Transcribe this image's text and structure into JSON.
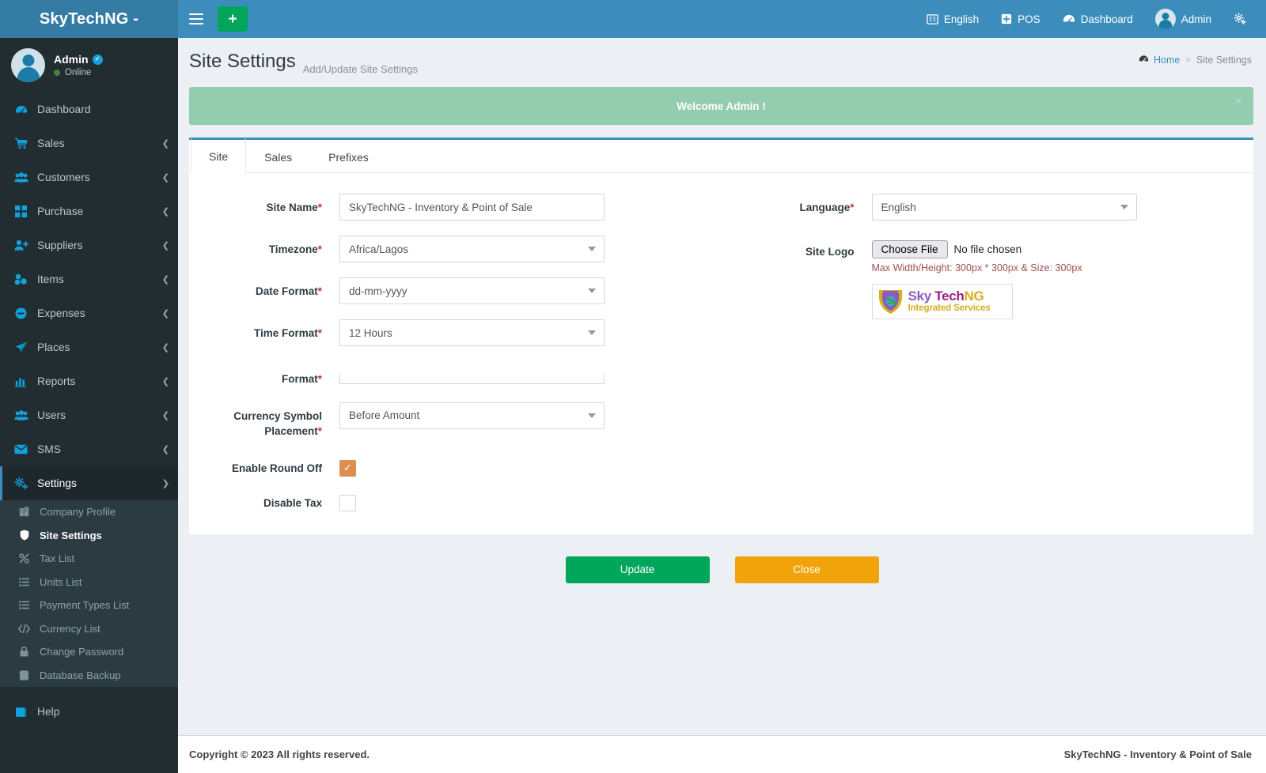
{
  "topbar": {
    "brand": "SkyTechNG -",
    "menu_toggle_icon": "hamburger-icon",
    "add_label": "+",
    "right_items": [
      {
        "label": "English",
        "icon": "language-icon"
      },
      {
        "label": "POS",
        "icon": "plus-square-icon"
      },
      {
        "label": "Dashboard",
        "icon": "dashboard-icon"
      },
      {
        "label": "Admin",
        "icon": "user-avatar-icon"
      },
      {
        "label": "",
        "icon": "gear-icon"
      }
    ]
  },
  "sidebar": {
    "user": {
      "name": "Admin",
      "status": "Online",
      "verified_icon": "verified-badge-icon"
    },
    "items": [
      {
        "label": "Dashboard",
        "icon": "dashboard-icon",
        "arrow": false
      },
      {
        "label": "Sales",
        "icon": "cart-icon",
        "arrow": true
      },
      {
        "label": "Customers",
        "icon": "users-group-icon",
        "arrow": true
      },
      {
        "label": "Purchase",
        "icon": "grid-icon",
        "arrow": true
      },
      {
        "label": "Suppliers",
        "icon": "user-plus-icon",
        "arrow": true
      },
      {
        "label": "Items",
        "icon": "cubes-icon",
        "arrow": true
      },
      {
        "label": "Expenses",
        "icon": "minus-circle-icon",
        "arrow": true
      },
      {
        "label": "Places",
        "icon": "paper-plane-icon",
        "arrow": true
      },
      {
        "label": "Reports",
        "icon": "bar-chart-icon",
        "arrow": true
      },
      {
        "label": "Users",
        "icon": "users-group-icon",
        "arrow": true
      },
      {
        "label": "SMS",
        "icon": "envelope-icon",
        "arrow": true
      },
      {
        "label": "Settings",
        "icon": "gears-icon",
        "arrow": true,
        "expanded": true,
        "active": true
      }
    ],
    "settings_submenu": [
      {
        "label": "Company Profile",
        "icon": "building-icon"
      },
      {
        "label": "Site Settings",
        "icon": "shield-icon",
        "active": true
      },
      {
        "label": "Tax List",
        "icon": "percent-icon"
      },
      {
        "label": "Units List",
        "icon": "list-icon"
      },
      {
        "label": "Payment Types List",
        "icon": "list-icon"
      },
      {
        "label": "Currency List",
        "icon": "code-icon"
      },
      {
        "label": "Change Password",
        "icon": "lock-icon"
      },
      {
        "label": "Database Backup",
        "icon": "database-icon"
      }
    ],
    "help": {
      "label": "Help",
      "icon": "book-icon"
    }
  },
  "page": {
    "title": "Site Settings",
    "subtitle": "Add/Update Site Settings",
    "breadcrumb": {
      "home": "Home",
      "separator": ">",
      "current": "Site Settings",
      "home_icon": "dashboard-icon"
    },
    "alert": {
      "text": "Welcome Admin !",
      "close_icon": "close-icon",
      "color": "#93ccaf"
    }
  },
  "tabs": [
    {
      "label": "Site",
      "active": true
    },
    {
      "label": "Sales",
      "active": false
    },
    {
      "label": "Prefixes",
      "active": false
    }
  ],
  "form": {
    "left": {
      "site_name": {
        "label": "Site Name",
        "required": "*",
        "value": "SkyTechNG - Inventory & Point of Sale"
      },
      "timezone": {
        "label": "Timezone",
        "required": "*",
        "value": "Africa/Lagos"
      },
      "date_format": {
        "label": "Date Format",
        "required": "*",
        "value": "dd-mm-yyyy"
      },
      "time_format": {
        "label": "Time Format",
        "required": "*",
        "value": "12 Hours"
      },
      "format": {
        "label": "Format",
        "required": "*",
        "value": ""
      },
      "currency_symbol_placement": {
        "label": "Currency Symbol Placement",
        "required": "*",
        "value": "Before Amount"
      },
      "enable_round_off": {
        "label": "Enable Round Off",
        "checked": true,
        "check_icon": "check-icon"
      },
      "disable_tax": {
        "label": "Disable Tax",
        "checked": false
      }
    },
    "right": {
      "language": {
        "label": "Language",
        "required": "*",
        "value": "English"
      },
      "site_logo": {
        "label": "Site Logo",
        "choose_button": "Choose File",
        "file_status": "No file chosen",
        "hint": "Max Width/Height: 300px * 300px & Size: 300px",
        "logo": {
          "line1_a": "Sky ",
          "line1_b": "Tech",
          "line1_c": "NG",
          "line2": "Integrated Services"
        }
      }
    }
  },
  "actions": {
    "update_label": "Update",
    "close_label": "Close",
    "update_color": "#00a65a",
    "close_color": "#f0a30a"
  },
  "footer": {
    "left": "Copyright © 2023 All rights reserved.",
    "right": "SkyTechNG - Inventory & Point of Sale"
  }
}
